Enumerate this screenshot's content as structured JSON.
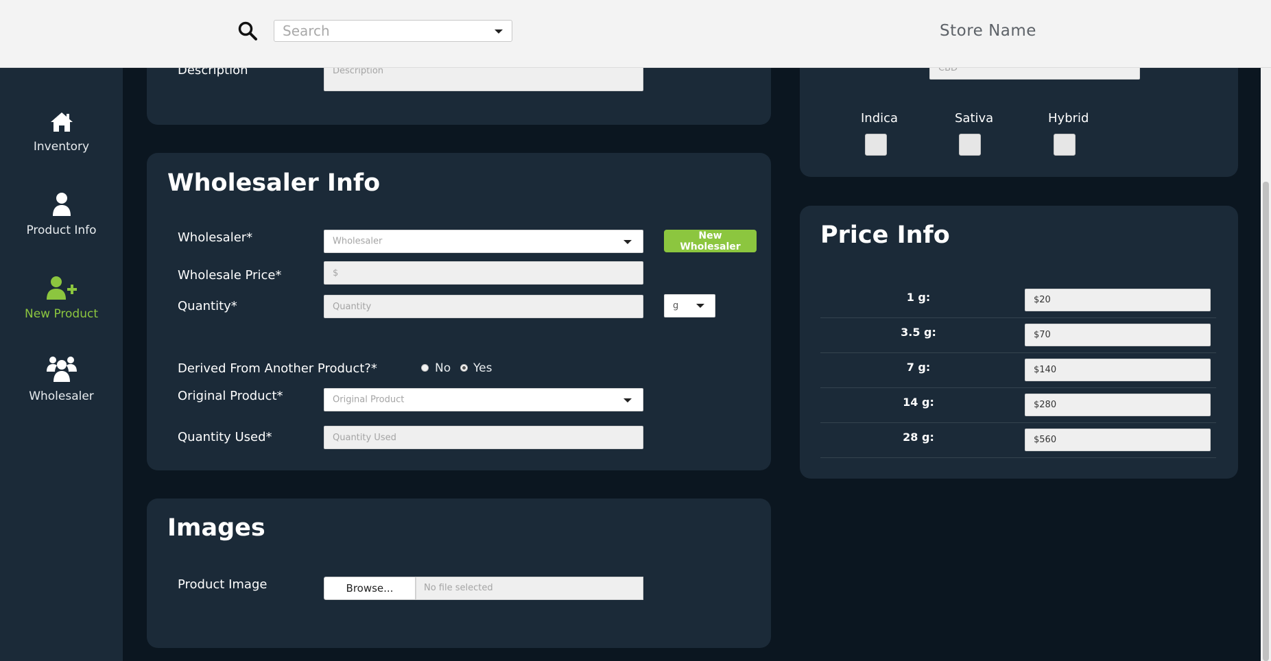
{
  "header": {
    "search_placeholder": "Search",
    "store_name": "Store Name"
  },
  "sidebar": {
    "items": [
      {
        "label": "Inventory",
        "icon": "home-icon"
      },
      {
        "label": "Product Info",
        "icon": "user-icon"
      },
      {
        "label": "New Product",
        "icon": "user-plus-icon",
        "active": true
      },
      {
        "label": "Wholesaler",
        "icon": "users-icon"
      }
    ]
  },
  "description_section": {
    "label": "Description",
    "placeholder": "Description"
  },
  "strain_section": {
    "cbd_placeholder": "CBD",
    "types": [
      "Indica",
      "Sativa",
      "Hybrid"
    ]
  },
  "wholesaler_info": {
    "title": "Wholesaler Info",
    "wholesaler_label": "Wholesaler*",
    "wholesaler_placeholder": "Wholesaler",
    "new_wholesaler_button": "New Wholesaler",
    "wholesale_price_label": "Wholesale Price*",
    "wholesale_price_placeholder": "$",
    "quantity_label": "Quantity*",
    "quantity_placeholder": "Quantity",
    "unit_value": "g",
    "derived_label": "Derived From Another Product?*",
    "derived_options": [
      "No",
      "Yes"
    ],
    "derived_selected": "Yes",
    "original_product_label": "Original Product*",
    "original_product_placeholder": "Original Product",
    "quantity_used_label": "Quantity Used*",
    "quantity_used_placeholder": "Quantity Used"
  },
  "price_info": {
    "title": "Price Info",
    "rows": [
      {
        "label": "1 g:",
        "value": "$20"
      },
      {
        "label": "3.5 g:",
        "value": "$70"
      },
      {
        "label": "7 g:",
        "value": "$140"
      },
      {
        "label": "14 g:",
        "value": "$280"
      },
      {
        "label": "28 g:",
        "value": "$560"
      }
    ]
  },
  "images": {
    "title": "Images",
    "product_image_label": "Product Image",
    "browse_label": "Browse...",
    "file_status": "No file selected"
  },
  "colors": {
    "accent": "#8cc63f",
    "page_bg": "#0b1620",
    "panel_bg": "#1b2a38",
    "topbar_bg": "#f3f3f3"
  }
}
